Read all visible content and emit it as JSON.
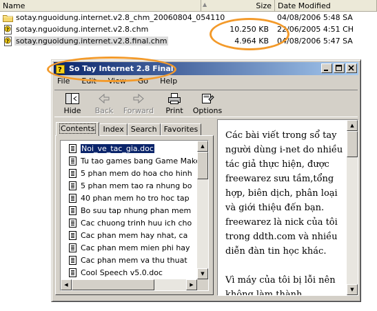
{
  "explorer": {
    "columns": {
      "name": "Name",
      "size": "Size",
      "date": "Date Modified"
    },
    "files": [
      {
        "icon": "folder-icon",
        "name": "sotay.nguoidung.internet.v2.8_chm_20060804_054110",
        "size": "",
        "date": "04/08/2006 5:48 SA"
      },
      {
        "icon": "chm-file-icon",
        "name": "sotay.nguoidung.internet.v2.8.chm",
        "size": "10.250 KB",
        "date": "22/06/2005 4:51 CH"
      },
      {
        "icon": "chm-file-icon",
        "name": "sotay.nguoidung.internet.v2.8.final.chm",
        "size": "4.964 KB",
        "date": "04/08/2006 5:47 SA"
      }
    ]
  },
  "help_window": {
    "title": "So Tay Internet 2.8 Final",
    "menu": [
      "File",
      "Edit",
      "View",
      "Go",
      "Help"
    ],
    "toolbar": [
      {
        "icon": "hide-icon",
        "label": "Hide",
        "enabled": true
      },
      {
        "icon": "back-arrow-icon",
        "label": "Back",
        "enabled": false
      },
      {
        "icon": "forward-arrow-icon",
        "label": "Forward",
        "enabled": false
      },
      {
        "icon": "printer-icon",
        "label": "Print",
        "enabled": true
      },
      {
        "icon": "options-icon",
        "label": "Options",
        "enabled": true
      }
    ],
    "tabs": [
      "Contents",
      "Index",
      "Search",
      "Favorites"
    ],
    "active_tab": "Contents",
    "toc_items": [
      "Noi_ve_tac_gia.doc",
      "Tu tao games bang Game Maker",
      "5 phan mem do hoa cho hinh",
      "5 phan mem tao ra nhung bo",
      "40 phan mem ho tro hoc tap",
      "Bo suu tap nhung phan mem",
      "Cac chuong trinh huu ich cho",
      "Cac phan mem hay nhat, ca",
      "Cac phan mem mien phi hay",
      "Cac phan mem va thu thuat",
      "Cool Speech v5.0.doc"
    ],
    "selected_toc_index": 0,
    "content_paragraphs": [
      "Các bài viết trong sổ tay người dùng i-net do nhiều tác giả thực hiện, được freewarez sưu tầm,tổng hợp, biên dịch, phân loại và giới thiệu đến bạn. freewarez là nick của tôi trong ddth.com và nhiều diễn đàn tin học khác.",
      "Vì máy của tôi bị lỗi nên không làm thành"
    ]
  },
  "colors": {
    "annotation_orange": "#f39a2a",
    "title_gradient_start": "#0a246a",
    "title_gradient_end": "#a6caf0",
    "window_face": "#d4d0c8"
  }
}
